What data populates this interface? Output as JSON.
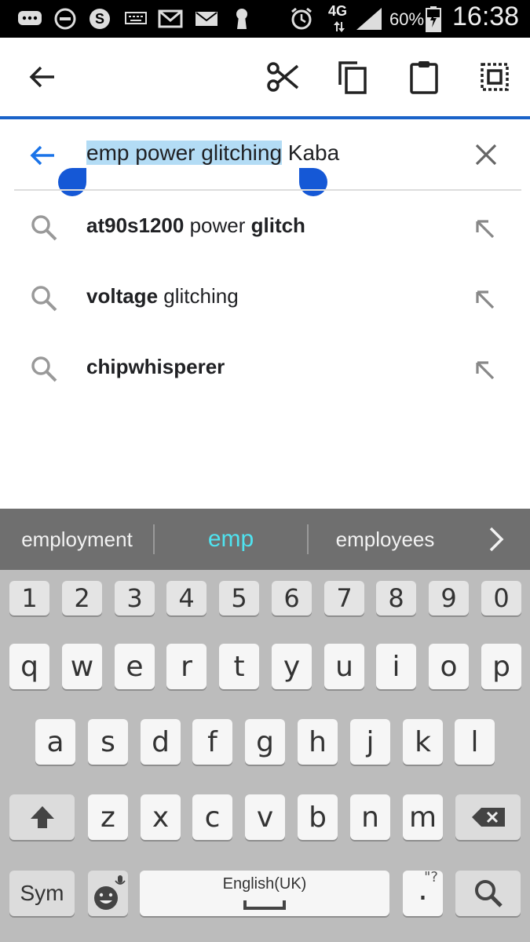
{
  "status_bar": {
    "network": "4G",
    "battery": "60%",
    "time": "16:38"
  },
  "toolbar": {
    "icons": [
      "back-arrow-icon",
      "cut-icon",
      "copy-icon",
      "paste-icon",
      "select-all-icon"
    ]
  },
  "search": {
    "selected_text": "emp power glitching",
    "rest_text": " Kaba"
  },
  "suggestions": [
    {
      "parts": [
        {
          "t": "at90s1200",
          "b": true
        },
        {
          "t": " power ",
          "b": false
        },
        {
          "t": "glitch",
          "b": true
        }
      ]
    },
    {
      "parts": [
        {
          "t": "voltage",
          "b": true
        },
        {
          "t": " glitching",
          "b": false
        }
      ]
    },
    {
      "parts": [
        {
          "t": "chipwhisperer",
          "b": true
        }
      ]
    }
  ],
  "predictions": {
    "left": "employment",
    "middle": "emp",
    "right": "employees"
  },
  "keyboard": {
    "row_numbers": [
      "1",
      "2",
      "3",
      "4",
      "5",
      "6",
      "7",
      "8",
      "9",
      "0"
    ],
    "row_top": [
      "q",
      "w",
      "e",
      "r",
      "t",
      "y",
      "u",
      "i",
      "o",
      "p"
    ],
    "row_middle": [
      "a",
      "s",
      "d",
      "f",
      "g",
      "h",
      "j",
      "k",
      "l"
    ],
    "row_bottom": [
      "z",
      "x",
      "c",
      "v",
      "b",
      "n",
      "m"
    ],
    "sym_label": "Sym",
    "space_label": "English(UK)",
    "period_label": ".",
    "period_hint": "\"?",
    "colors": {
      "accent": "#1a63c9",
      "selection": "#b3dcf5",
      "prediction_highlight": "#4fe3f0"
    }
  }
}
